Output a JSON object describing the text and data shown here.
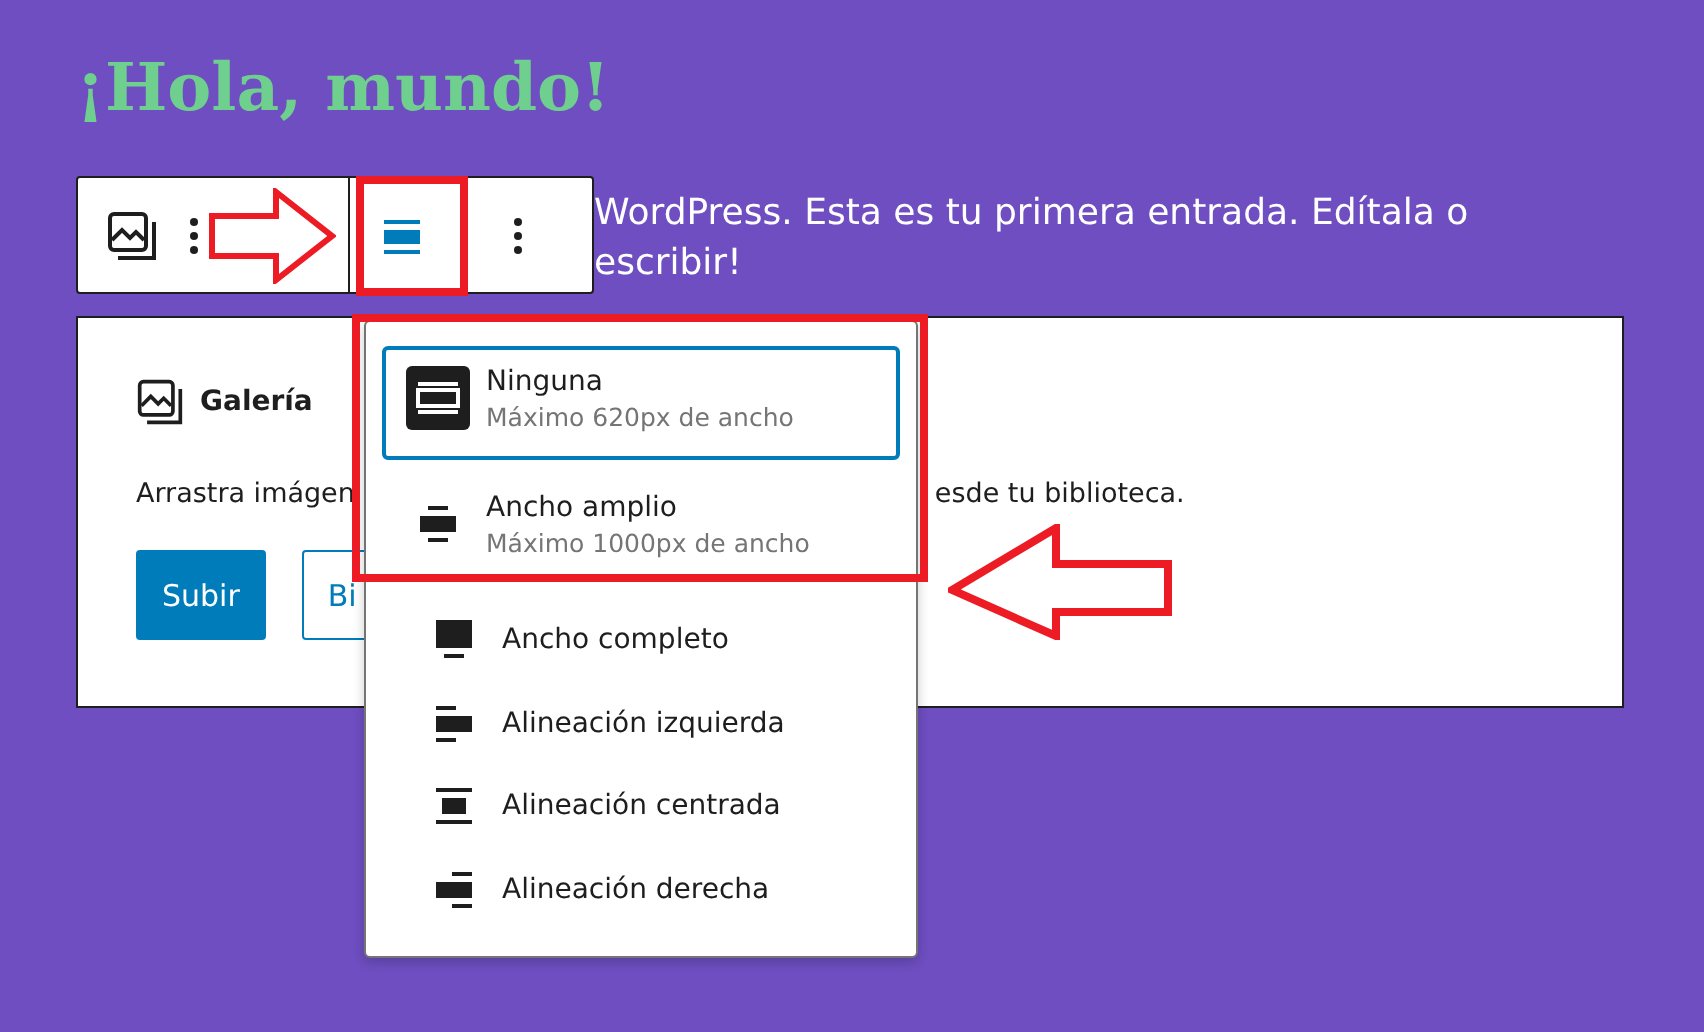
{
  "title": "¡Hola, mundo!",
  "paragraph": {
    "lines": [
      "WordPress. Esta es tu primera entrada. Edítala o",
      "escribir!"
    ]
  },
  "block": {
    "title": "Galería",
    "instructions_left": "Arrastra imágen",
    "instructions_right": "esde tu biblioteca.",
    "buttons": [
      {
        "label": "Subir",
        "kind": "primary"
      },
      {
        "label": "Bi",
        "kind": "secondary"
      }
    ]
  },
  "align_menu": {
    "items": [
      {
        "kind": "none",
        "label": "Ninguna",
        "description": "Máximo 620px de ancho",
        "selected": true
      },
      {
        "kind": "wide",
        "label": "Ancho amplio",
        "description": "Máximo 1000px de ancho",
        "selected": false
      },
      {
        "kind": "full",
        "label": "Ancho completo",
        "selected": false
      },
      {
        "kind": "left",
        "label": "Alineación izquierda",
        "selected": false
      },
      {
        "kind": "center",
        "label": "Alineación centrada",
        "selected": false
      },
      {
        "kind": "right",
        "label": "Alineación derecha",
        "selected": false
      }
    ]
  },
  "annotations": [
    {
      "kind": "box"
    },
    {
      "kind": "arrow_right"
    },
    {
      "kind": "box"
    },
    {
      "kind": "arrow_left"
    }
  ]
}
